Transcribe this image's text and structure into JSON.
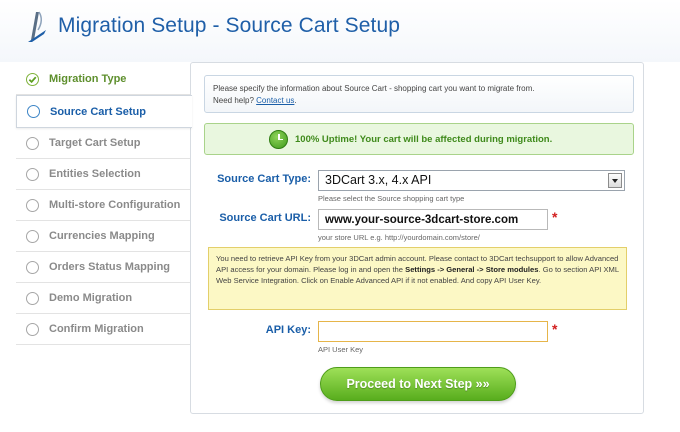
{
  "header": {
    "title": "Migration Setup - Source Cart Setup",
    "accent_color": "#1f5fa8"
  },
  "sidebar": {
    "items": [
      {
        "label": "Migration Type",
        "state": "done"
      },
      {
        "label": "Source Cart Setup",
        "state": "active"
      },
      {
        "label": "Target Cart Setup",
        "state": "pending"
      },
      {
        "label": "Entities Selection",
        "state": "pending"
      },
      {
        "label": "Multi-store Configuration",
        "state": "pending"
      },
      {
        "label": "Currencies Mapping",
        "state": "pending"
      },
      {
        "label": "Orders Status Mapping",
        "state": "pending"
      },
      {
        "label": "Demo Migration",
        "state": "pending"
      },
      {
        "label": "Confirm Migration",
        "state": "pending"
      }
    ]
  },
  "info": {
    "text": "Please specify the information about Source Cart - shopping cart you want to migrate from.",
    "help_prefix": "Need help?",
    "help_link": "Contact us",
    "help_suffix": "."
  },
  "uptime": {
    "text": "100% Uptime! Your cart will be affected during migration.",
    "icon": "clock-icon"
  },
  "form": {
    "cart_type": {
      "label": "Source Cart Type:",
      "value": "3DCart 3.x, 4.x API",
      "hint": "Please select the Source shopping cart type"
    },
    "cart_url": {
      "label": "Source Cart URL:",
      "value": "www.your-source-3dcart-store.com",
      "hint": "your store URL e.g. http://yourdomain.com/store/",
      "required": "*"
    },
    "warning": {
      "part1": "You need to retrieve API Key from your 3DCart admin account. Please contact to 3DCart techsupport to allow Advanced API access for your domain. Please log in and open the ",
      "bold": "Settings -> General -> Store modules",
      "part2": ". Go to section API XML Web Service Integration. Click on Enable Advanced API if it not enabled. And copy API User Key."
    },
    "api_key": {
      "label": "API Key:",
      "value": "",
      "hint": "API User Key",
      "required": "*"
    }
  },
  "actions": {
    "next_label": "Proceed to Next Step »»",
    "button_color": "#58ad1d"
  }
}
